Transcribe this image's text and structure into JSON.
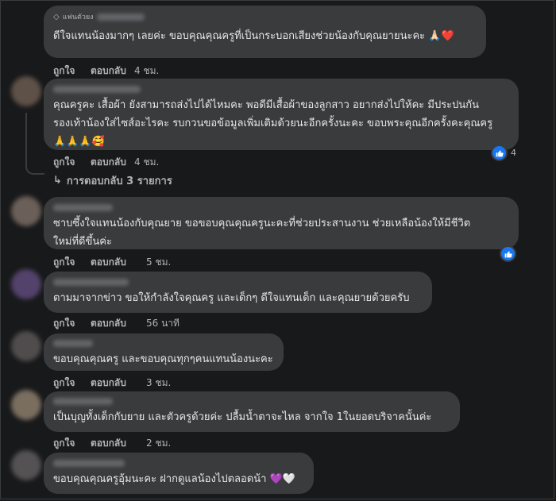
{
  "comments": [
    {
      "badge": "แฟนตัวยง",
      "text": "ดีใจแทนน้องมากๆ เลยค่ะ ขอบคุณคุณครูที่เป็นกระบอกเสียงช่วยน้องกับคุณยายนะคะ 🙏🏻❤️",
      "like": "ถูกใจ",
      "reply": "ตอบกลับ",
      "time": "4 ชม."
    },
    {
      "text": "คุณครูคะ เสื้อผ้า ยังสามารถส่งไปได้ไหมคะ พอดีมีเสื้อผ้าของลูกสาว อยากส่งไปให้คะ มีประปนกัน\nรองเท้าน้องใส่ไซส์อะไรคะ รบกวนขอข้อมูลเพิ่มเติมด้วยนะอีกครั้งนะคะ ขอบพระคุณอีกครั้งคะคุณครู\n🙏🙏🙏🥰",
      "like": "ถูกใจ",
      "reply": "ตอบกลับ",
      "time": "4 ชม.",
      "reaction_count": "4",
      "replies": "การตอบกลับ 3 รายการ"
    },
    {
      "text": "ซาบซึ้งใจแทนน้องกับคุณยาย ขอขอบคุณคุณครูนะคะที่ช่วยประสานงาน ช่วยเหลือน้องให้มีชีวิต\nใหม่ที่ดีขึ้นค่ะ",
      "like": "ถูกใจ",
      "reply": "ตอบกลับ",
      "time": "5 ชม."
    },
    {
      "text": "ตามมาจากข่าว ขอให้กำลังใจคุณครู และเด็กๆ ดีใจแทนเด็ก และคุณยายด้วยครับ",
      "like": "ถูกใจ",
      "reply": "ตอบกลับ",
      "time": "56 นาที"
    },
    {
      "text": "ขอบคุณคุณครู และขอบคุณทุกๆคนแทนน้องนะคะ",
      "like": "ถูกใจ",
      "reply": "ตอบกลับ",
      "time": "3 ชม."
    },
    {
      "text": "เป็นบุญทั้งเด็กกับยาย และตัวครูด้วยค่ะ ปลื้มน้ำตาจะไหล จากใจ 1ในยอดบริจาคนั้นค่ะ",
      "like": "ถูกใจ",
      "reply": "ตอบกลับ",
      "time": "2 ชม."
    },
    {
      "text": "ขอบคุณคุณครูอุ้มนะคะ ฝากดูแลน้องไปตลอดน้า 💜🤍"
    }
  ],
  "colors": {
    "bubble": "#3a3b3c",
    "background": "#18191a",
    "like_blue": "#1877f2"
  },
  "icons": {
    "like": "thumbs-up-icon",
    "reply_arrow": "reply-arrow-icon",
    "badge": "diamond-icon"
  }
}
